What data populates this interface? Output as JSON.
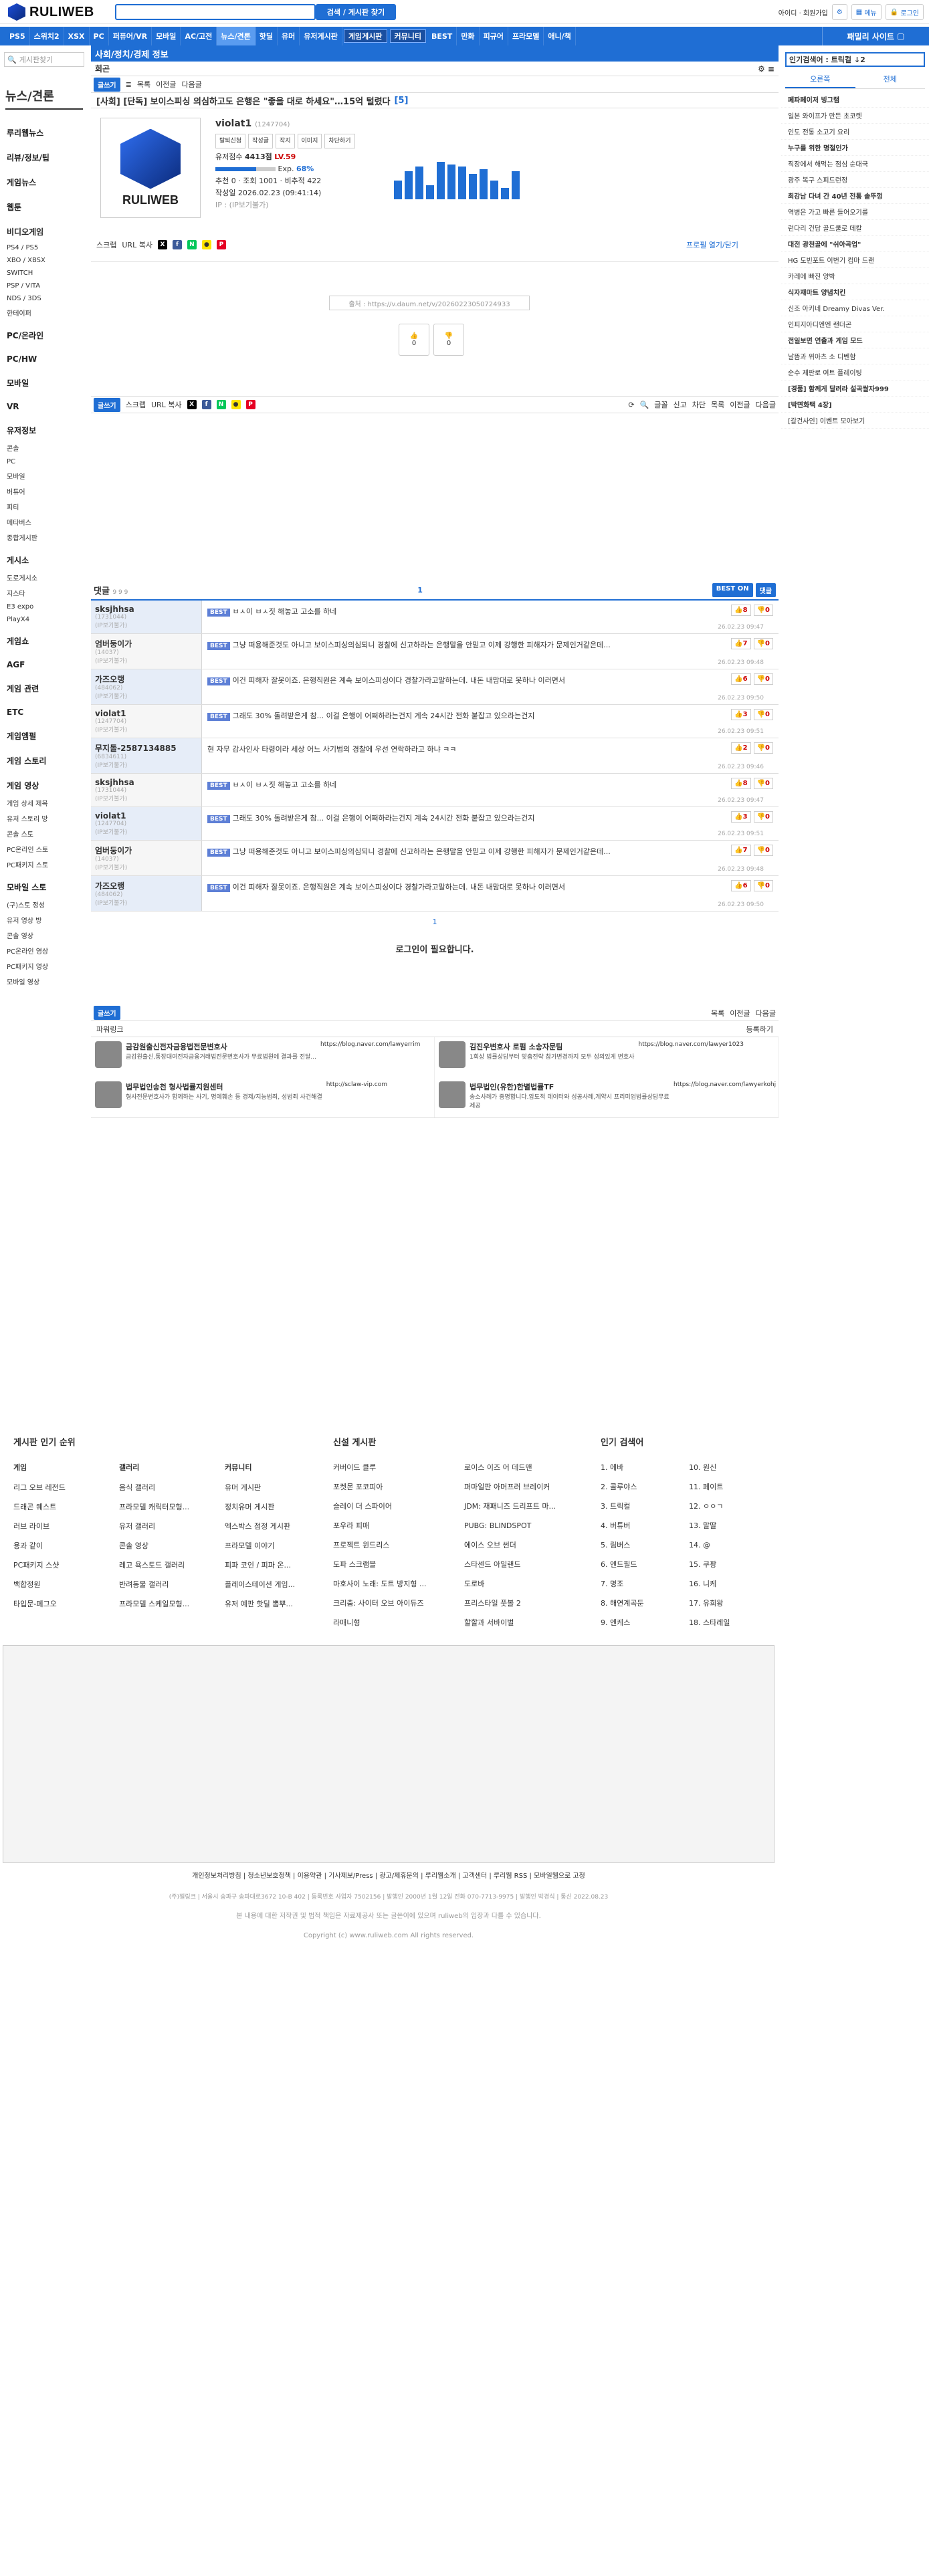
{
  "header": {
    "logo": "RULIWEB",
    "search_button": "검색 / 게시판 찾기",
    "id_label": "아이디 · 회원가입",
    "menu": "메뉴",
    "login": "로그인"
  },
  "nav": {
    "items": [
      "PS5",
      "스위치2",
      "XSX",
      "PC",
      "퍼퓨어/VR",
      "모바일",
      "AC/고전",
      "뉴스/견론",
      "핫딜",
      "유머",
      "유저게시판",
      "게임게시판",
      "커뮤니티",
      "BEST",
      "만화",
      "피규어",
      "프라모델",
      "애니/책"
    ],
    "right": "패밀리 사이트"
  },
  "left_sidebar": {
    "search_placeholder": "게시판찾기",
    "title": "뉴스/견론",
    "items": [
      "루리웹뉴스",
      "리뷰/정보/팁",
      "게임뉴스",
      "웹툰",
      "비디오게임",
      "PS4 / PS5",
      "XBO / XBSX",
      "SWITCH",
      "PSP / VITA",
      "NDS / 3DS",
      "한테이퍼",
      "PC/온라인",
      "PC/HW",
      "모바일",
      "VR",
      "유저정보",
      "콘솔",
      "PC",
      "모바일",
      "버튜어",
      "피티",
      "메타버스",
      "종합게시판",
      "게시소",
      "도로게시소",
      "지스타",
      "E3 expo",
      "PlayX4",
      "게임쇼",
      "AGF",
      "게임 관련",
      "ETC",
      "게임엠펄",
      "게임 스토리",
      "게임 영상",
      "게임 상세 제목",
      "유저 스토리 방",
      "콘솔 스토",
      "PC온라인 스토",
      "PC패키지 스토",
      "모바일 스토",
      "(구)스토 정성",
      "유저 영상 방",
      "콘솔 영상",
      "PC온라인 영상",
      "PC패키지 영상",
      "모바일 영상"
    ]
  },
  "main": {
    "breadcrumb": "사회/정치/경제 정보",
    "subhead": "회곤",
    "write": "글쓰기",
    "list": "목록",
    "prev": "이전글",
    "next": "다음글",
    "post_title": "[사회] [단독] 보이스피싱 의심하고도 은행은 \"좋을 대로 하세요\"…15억 털렸다",
    "comment_count": "[5]",
    "profile": {
      "name": "violat1",
      "uid": "(1247704)",
      "tags": [
        "탈퇴신청",
        "작성글",
        "작지",
        "이미지",
        "차단하기"
      ],
      "points_label": "유저점수",
      "points": "4413점",
      "level": "LV.59",
      "exp_label": "Exp.",
      "exp_pct": "68%",
      "exp_value": 0.68,
      "stats": "추천 0 · 조회 1001 · 비추적 422",
      "date": "작성일 2026.02.23 (09:41:14)",
      "ip": "IP : (IP보기불가)",
      "share_scrap": "스크랩",
      "share_url": "URL 복사",
      "profile_toggle": "프로필 열기/닫기"
    },
    "chart_bars": [
      40,
      60,
      70,
      30,
      80,
      75,
      70,
      55,
      65,
      40,
      25,
      60
    ],
    "embed_text": "출처 : https://v.daum.net/v/20260223050724933",
    "vote_up": "0",
    "vote_down": "0",
    "bottom_bar": {
      "write": "글쓰기",
      "scrap": "스크랩",
      "url": "URL 복사",
      "font": "글꼴",
      "report": "신고",
      "block": "차단",
      "list": "목록",
      "prev": "이전글",
      "next": "다음글"
    },
    "comments_title": "댓글",
    "comments_count": "9 9 9",
    "best_on": "BEST ON",
    "comment_btn": "댓글",
    "page1": "1",
    "comments": [
      {
        "user": "sksjhhsa",
        "uid": "(1731044)",
        "ip": "(IP보기불가)",
        "best": "BEST",
        "text": "ㅂㅅ이 ㅂㅅ짓 해놓고 고소를 하네",
        "up": "8",
        "down": "0",
        "time": "26.02.23 09:47"
      },
      {
        "user": "엄버둥이가",
        "uid": "(14037)",
        "ip": "(IP보기불가)",
        "best": "BEST",
        "text": "그냥 떠용해준것도 아니고 보이스피싱의심되니 경찰에 신고하라는 은행말을 안믿고 이제 강행한 피해자가 문제인거같은데...",
        "up": "7",
        "down": "0",
        "time": "26.02.23 09:48"
      },
      {
        "user": "가즈오랭",
        "uid": "(484062)",
        "ip": "(IP보기불가)",
        "best": "BEST",
        "text": "이건 피해자 잘못이죠. 은행직원은 계속 보이스피싱이다 경찰가라고말하는데.      내돈 내맘대로 못하나 이러면서",
        "up": "6",
        "down": "0",
        "time": "26.02.23 09:50"
      },
      {
        "user": "violat1",
        "uid": "(1247704)",
        "ip": "(IP보기불가)",
        "best": "BEST",
        "text": "그래도 30% 돌려받은게 참... 이걸 은행이 어쩌하라는건지 계속 24시간 전화 붙잡고 있으라는건지",
        "up": "3",
        "down": "0",
        "time": "26.02.23 09:51"
      },
      {
        "user": "무지돌-2587134885",
        "uid": "(6834611)",
        "ip": "(IP보기불가)",
        "best": "",
        "text": "현 자무 감사인사 타령이라 세상 어느 사기범의 경찰에 우선 연락하라고 하냐 ㅋㅋ",
        "up": "2",
        "down": "0",
        "time": "26.02.23 09:46"
      },
      {
        "user": "sksjhhsa",
        "uid": "(1731044)",
        "ip": "(IP보기불가)",
        "best": "BEST",
        "text": "ㅂㅅ이 ㅂㅅ짓 해놓고 고소를 하네",
        "up": "8",
        "down": "0",
        "time": "26.02.23 09:47"
      },
      {
        "user": "violat1",
        "uid": "(1247704)",
        "ip": "(IP보기불가)",
        "best": "BEST",
        "text": "그래도 30% 돌려받은게 참... 이걸 은행이 어쩌하라는건지 계속 24시간 전화 붙잡고 있으라는건지",
        "up": "3",
        "down": "0",
        "time": "26.02.23 09:51"
      },
      {
        "user": "엄버둥이가",
        "uid": "(14037)",
        "ip": "(IP보기불가)",
        "best": "BEST",
        "text": "그냥 떠용해준것도 아니고 보이스피싱의심되니 경찰에 신고하라는 은행말을 안믿고 이제 강행한 피해자가 문제인거같은데...",
        "up": "7",
        "down": "0",
        "time": "26.02.23 09:48"
      },
      {
        "user": "가즈오랭",
        "uid": "(484062)",
        "ip": "(IP보기불가)",
        "best": "BEST",
        "text": "이건 피해자 잘못이죠. 은행직원은 계속 보이스피싱이다 경찰가라고말하는데.      내돈 내맘대로 못하나 이러면서",
        "up": "6",
        "down": "0",
        "time": "26.02.23 09:50"
      }
    ],
    "login_required": "로그인이 필요합니다.",
    "powerlink": "파워링크",
    "register": "등록하기",
    "ads": [
      {
        "title": "금감원출신전자금융법전문변호사",
        "desc": "금감원출신,통장대여전자금융거래법전문변호사가 무료법원에 결과를 전달...",
        "url": "https://blog.naver.com/lawyerrim"
      },
      {
        "title": "김진우변호사 로펌 소송자문팀",
        "desc": "1회상 법률상담부터 맞춤전략 참가변경까지 모두 성의있게 변호사",
        "url": "https://blog.naver.com/lawyer1023"
      },
      {
        "title": "법무법인송천 형사법률지원센터",
        "desc": "형사전문변호사가 함께하는 사기, 명예훼손 등 경제/지능범죄, 성범죄 사건해결",
        "url": "http://sclaw-vip.com"
      },
      {
        "title": "법무법인(유한)한별법률TF",
        "desc": "송소사례가 증명합니다.압도적 데이터와 성공사례,계약시 프리미엄법률상담무료제공",
        "url": "https://blog.naver.com/lawyerkohj"
      }
    ]
  },
  "footer": {
    "ranking_title": "게시판 인기 순위",
    "game_title": "게임",
    "gallery_title": "갤러리",
    "community_title": "커뮤니티",
    "new_title": "신설 게시판",
    "popular_title": "인기 검색어",
    "game_list": [
      "리그 오브 레전드",
      "드래곤 퀘스트",
      "러브 라이브",
      "용과 같이",
      "PC패키지 스샷",
      "백합정원",
      "타입문-페그오"
    ],
    "gallery_list": [
      "음식 갤러리",
      "프라모델 캐릭터모형...",
      "유저 갤러리",
      "콘솔 영상",
      "레고 욕스토드 갤러리",
      "반려동물 갤러리",
      "프라모델 스케일모형..."
    ],
    "community_list": [
      "유머 게시판",
      "정치유머 게시판",
      "엑스박스 점정 게시판",
      "프라모델 이야기",
      "피파 코인 / 피파 온...",
      "플레이스테이션 게임...",
      "유저 예판 핫딜 뽐뿌..."
    ],
    "new_list1": [
      "커버이드 클루",
      "포켓몬 포코피아",
      "슬레이 더 스파이어",
      "포우라 피매",
      "프로젝트 윈드리스",
      "도파 스크램블",
      "마호사이 노래: 도트 방지형 ...",
      "크리춤: 사이터 오브 아이듀즈",
      "라매니형"
    ],
    "new_list2": [
      "로이스 이즈 어 데드맨",
      "퍼마일판 아머프러 브레이커",
      "JDM: 재패니즈 드리프트 마...",
      "PUBG: BLINDSPOT",
      "에이스 오브 썬더",
      "스타센드 아일랜드",
      "도로바",
      "프리스타일 풋볼 2",
      "할할과 서바이벌"
    ],
    "popular1": [
      "1. 에바",
      "2. 콜루야스",
      "3. 트릭컬",
      "4. 버튜버",
      "5. 림버스",
      "6. 엔드필드",
      "7. 명조",
      "8. 해연계곡둔",
      "9. 엔케스"
    ],
    "popular2": [
      "10. 원신",
      "11. 페이트",
      "12. ㅇㅇㄱ",
      "13. 말딸",
      "14. @",
      "15. 쿠팡",
      "16. 니케",
      "17. 유희왕",
      "18. 스타레일"
    ],
    "links": "개인정보처리방침 | 청소년보호정책 | 이용약관 | 기사제보/Press | 광고/제휴문의 | 루리웹소개 | 고객센터 | 루리웹 RSS | 모바일웹으로 고정",
    "company": "(주)젤링크 | 서울시 송파구 송파대로3672 10-B 402 | 등록번호 사업자 7502156 | 발행인 2000년 1월 12일 전화 070-7713-9975 | 발행인 박경식 | 통신 2022.08.23",
    "notice": "본 내용에 대한 저작권 및 법적 책임은 자료제공사 또는 글쓴이에 있으며 ruliweb의 입장과 다를 수 있습니다.",
    "copyright": "Copyright (c) www.ruliweb.com All rights reserved."
  },
  "right_sidebar": {
    "search": "인기검색어 : 트릭컬 ↓2",
    "tab1": "오른쪽",
    "tab2": "전체",
    "items": [
      {
        "t": "페파페이저 빙그램",
        "b": true
      },
      {
        "t": "일본 와이프가 만든 초코렛",
        "b": false
      },
      {
        "t": "인도 전통 소고기 요리",
        "b": false
      },
      {
        "t": "누구를 위한 명절인가",
        "b": true
      },
      {
        "t": "직장에서 해먹는 점심 순대국",
        "b": false
      },
      {
        "t": "광주 복구 스피드런정",
        "b": false
      },
      {
        "t": "최강남 다녀 간 40년 전통 솥뚜껑",
        "b": true
      },
      {
        "t": "역병은 가고 빠른 들어오기를",
        "b": false
      },
      {
        "t": "런다리 건담 골드쿨로 데칼",
        "b": false
      },
      {
        "t": "대전 광천골에 \"쉬아곡업\"",
        "b": true
      },
      {
        "t": "HG 도빈포트 이번기 컴마 드랜",
        "b": false
      },
      {
        "t": "카레에 빠진 양박",
        "b": false
      },
      {
        "t": "식자재마트 양념치킨",
        "b": true
      },
      {
        "t": "신조 아키네 Dreamy Divas Ver.",
        "b": false
      },
      {
        "t": "인피지아디엔엔 랜더곤",
        "b": false
      },
      {
        "t": "전일보면 연출과 게임 모드",
        "b": true
      },
      {
        "t": "날뜸과 위아츠 소 디벤함",
        "b": false
      },
      {
        "t": "순수 제판로 여트 플레이팅",
        "b": false
      },
      {
        "t": "[경품] 함께게 달려라 설곡쌀자999",
        "b": true
      },
      {
        "t": "[박면화택 4장]",
        "b": true
      },
      {
        "t": "[갈건사인] 이벤트 모아보기",
        "b": false
      }
    ]
  }
}
